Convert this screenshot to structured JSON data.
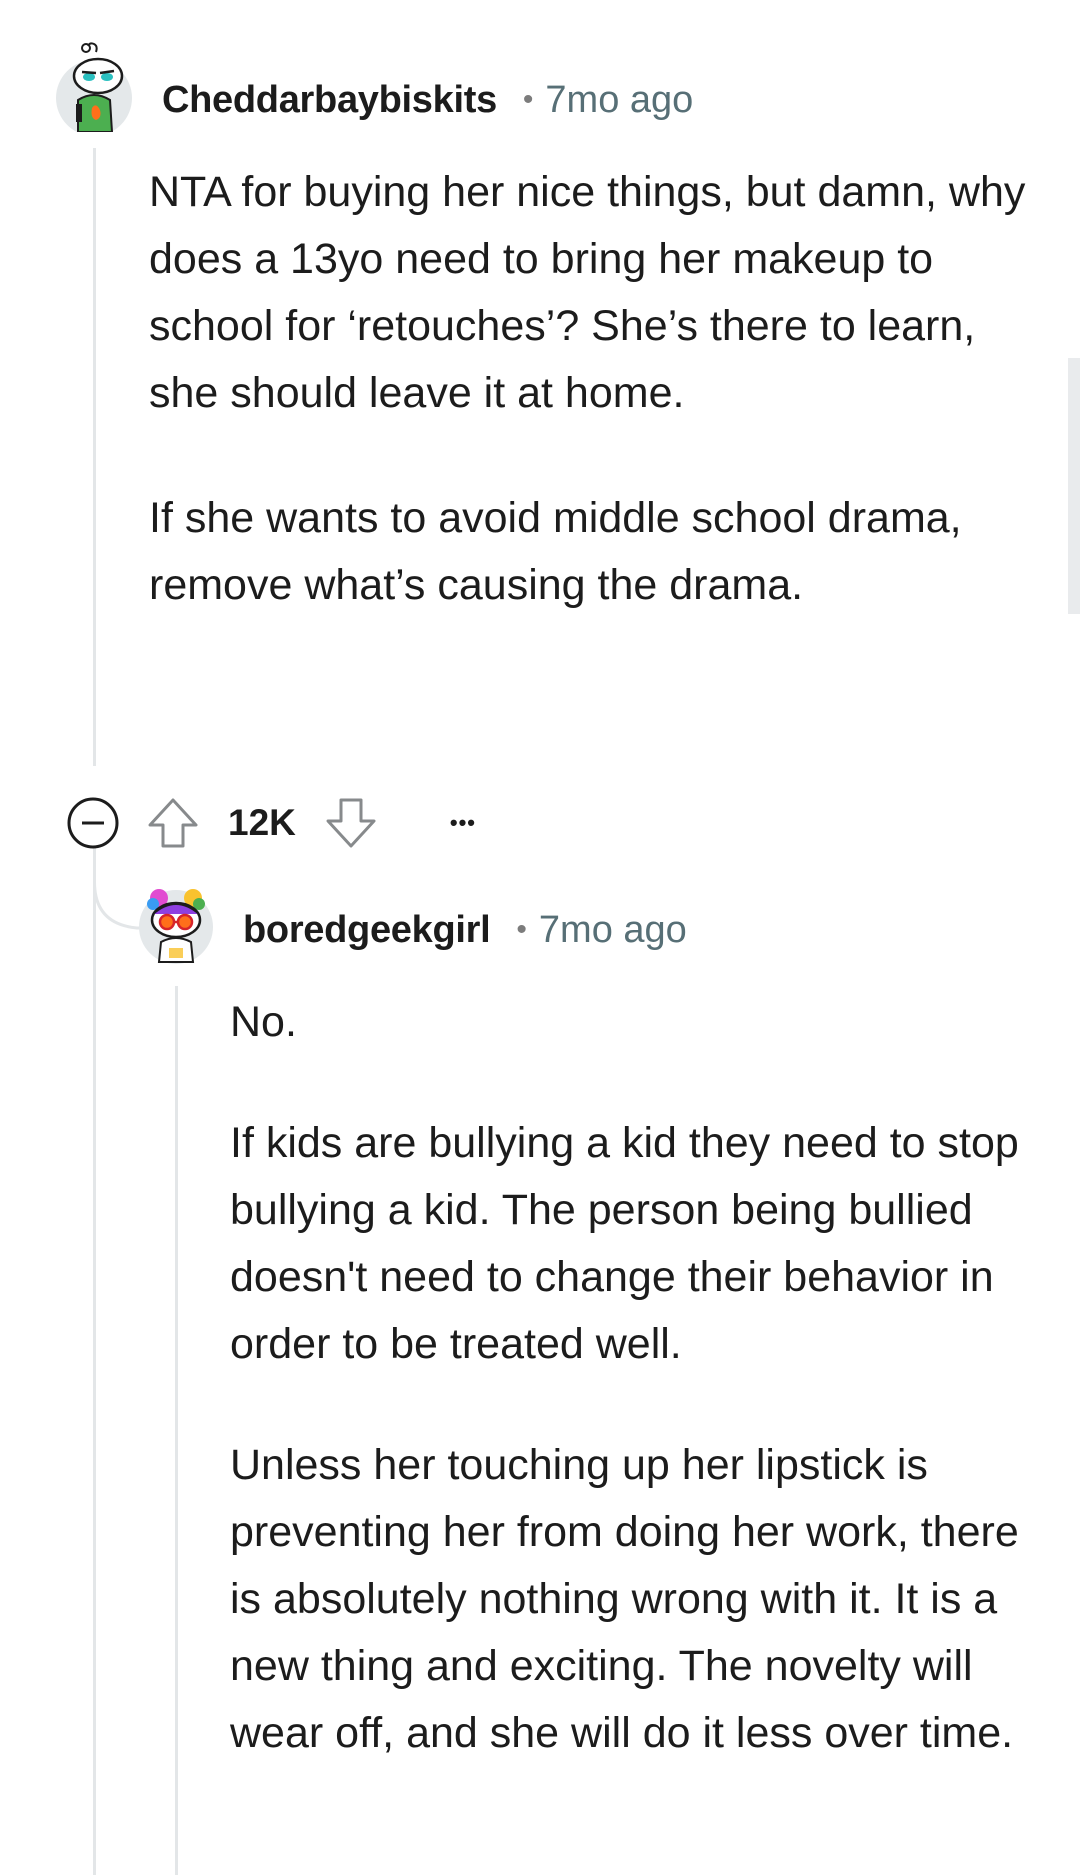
{
  "comments": [
    {
      "author": "Cheddarbaybiskits",
      "separator": "•",
      "time": "7mo ago",
      "paragraphs": [
        "NTA for buying her nice things, but damn, why does a 13yo need to bring her makeup to school for ‘retouches’? She’s there to learn, she should leave it at home.",
        "If she wants to avoid middle school drama, remove what’s causing the drama."
      ],
      "votes": "12K",
      "more_label": "•••"
    },
    {
      "author": "boredgeekgirl",
      "separator": "•",
      "time": "7mo ago",
      "paragraphs": [
        "No.",
        "If kids are bullying a kid they need to stop bullying a kid. The person being bullied doesn't need to change their behavior in order to be treated well.",
        "Unless her touching up her lipstick is preventing her from doing her work, there is absolutely nothing wrong with it. It is a new thing and exciting. The novelty will wear off, and she will do it less over time."
      ]
    }
  ],
  "icons": {
    "collapse": "collapse-icon",
    "upvote": "upvote-icon",
    "downvote": "downvote-icon",
    "more": "more-options-icon"
  },
  "colors": {
    "text": "#1c1c1c",
    "meta": "#576f76",
    "thread_line": "#e3e6e8",
    "icon": "#878a8c"
  }
}
